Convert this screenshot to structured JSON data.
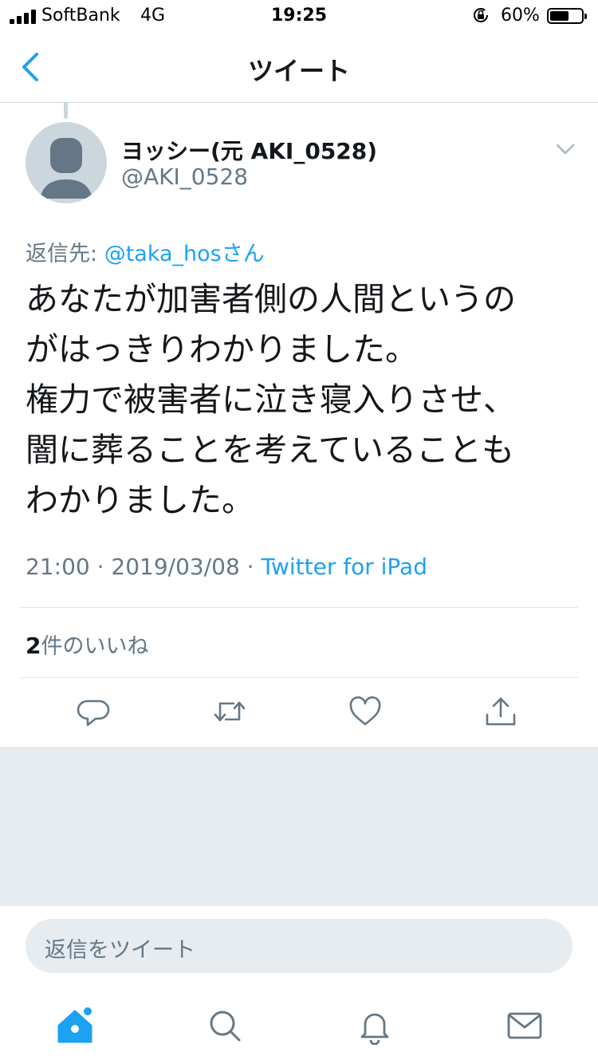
{
  "status": {
    "carrier": "SoftBank",
    "network": "4G",
    "time": "19:25",
    "battery": "60%",
    "battery_level": 0.6
  },
  "nav": {
    "title": "ツイート"
  },
  "tweet": {
    "display_name": "ヨッシー(元 AKI_0528)",
    "handle": "@AKI_0528",
    "reply_prefix": "返信先: ",
    "reply_to": "@taka_hosさん",
    "text": "あなたが加害者側の人間というの\nがはっきりわかりました。\n権力で被害者に泣き寝入りさせ、\n闇に葬ることを考えていることも\nわかりました。",
    "timestamp": "21:00 · 2019/03/08 · ",
    "source": "Twitter for iPad",
    "like_count": "2",
    "like_label": "件のいいね"
  },
  "compose": {
    "placeholder": "返信をツイート"
  },
  "colors": {
    "accent": "#1da1f2",
    "secondary_text": "#657786",
    "divider": "#e1e8ed",
    "background_gray": "#e6ecf0"
  },
  "tabbar": {
    "items": [
      "home-icon",
      "search-icon",
      "notifications-icon",
      "messages-icon"
    ]
  }
}
